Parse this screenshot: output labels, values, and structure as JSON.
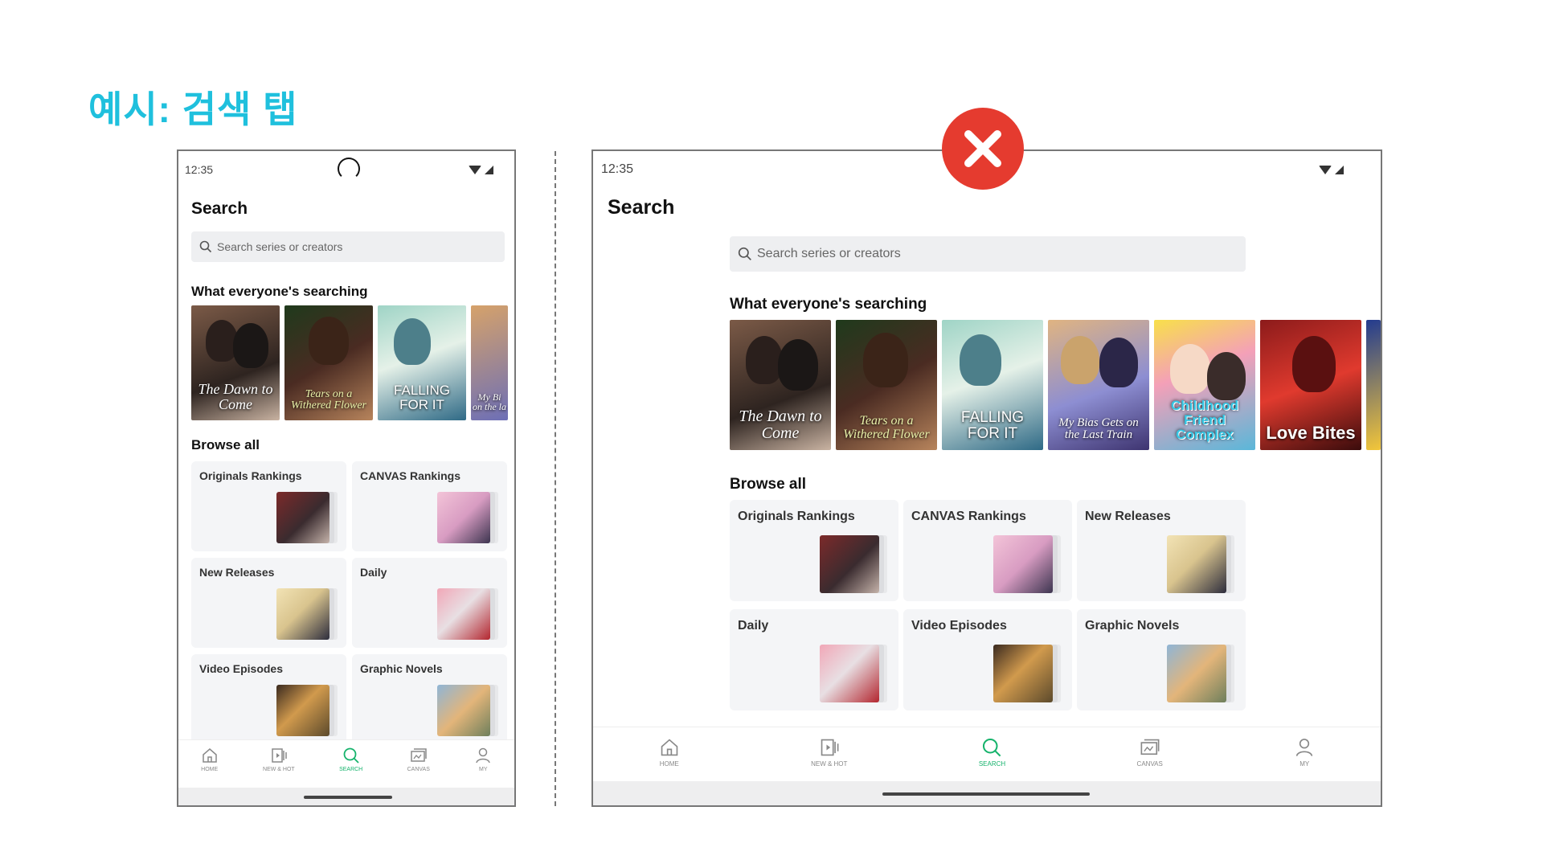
{
  "slide_title": "예시: 검색 탭",
  "colors": {
    "accent": "#1fc0dd",
    "active_nav": "#16b36c",
    "error": "#e53b2f"
  },
  "error_icon": "x-mark-icon",
  "status_time": "12:35",
  "page_title": "Search",
  "search_placeholder": "Search series or creators",
  "trending_title": "What everyone's searching",
  "browse_title": "Browse all",
  "phone": {
    "covers": [
      {
        "title": "The Dawn to Come"
      },
      {
        "title": "Tears on a Withered Flower"
      },
      {
        "title": "FALLING FOR IT"
      },
      {
        "title": "My Bi on the la"
      }
    ],
    "categories": [
      "Originals Rankings",
      "CANVAS Rankings",
      "New Releases",
      "Daily",
      "Video Episodes",
      "Graphic Novels"
    ]
  },
  "tablet": {
    "covers": [
      {
        "title": "The Dawn to Come"
      },
      {
        "title": "Tears on a Withered Flower"
      },
      {
        "title": "FALLING FOR IT"
      },
      {
        "title": "My Bias Gets on the Last Train"
      },
      {
        "title": "Childhood Friend Complex"
      },
      {
        "title": "Love Bites"
      }
    ],
    "categories": [
      "Originals Rankings",
      "CANVAS Rankings",
      "New Releases",
      "Daily",
      "Video Episodes",
      "Graphic Novels"
    ]
  },
  "nav": [
    {
      "label": "HOME",
      "icon": "home-icon"
    },
    {
      "label": "NEW & HOT",
      "icon": "new-hot-icon"
    },
    {
      "label": "SEARCH",
      "icon": "search-icon",
      "active": true
    },
    {
      "label": "CANVAS",
      "icon": "canvas-icon"
    },
    {
      "label": "MY",
      "icon": "profile-icon"
    }
  ]
}
